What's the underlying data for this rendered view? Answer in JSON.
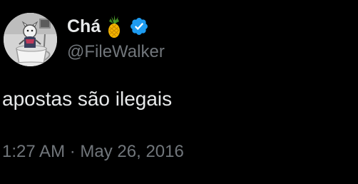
{
  "user": {
    "display_name": "Chá",
    "emoji_icon": "pineapple-emoji",
    "verified_icon": "verified-badge-icon",
    "handle": "@FileWalker",
    "avatar_icon": "avatar-image",
    "verified_color": "#1d9bf0"
  },
  "tweet": {
    "text": "apostas são ilegais",
    "time": "1:27 AM",
    "separator": "·",
    "date": "May 26, 2016"
  },
  "colors": {
    "background": "#000000",
    "primary_text": "#e7e9ea",
    "secondary_text": "#71767b"
  }
}
